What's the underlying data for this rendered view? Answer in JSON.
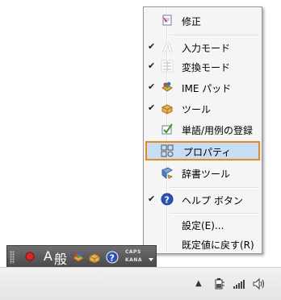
{
  "context_menu": {
    "items": [
      {
        "label": "修正",
        "checked": false,
        "icon": "edit-icon"
      },
      {
        "label": "入力モード",
        "checked": true,
        "icon": "input-mode-icon"
      },
      {
        "label": "変換モード",
        "checked": true,
        "icon": "conversion-mode-icon"
      },
      {
        "label": "IME パッド",
        "checked": true,
        "icon": "ime-pad-icon"
      },
      {
        "label": "ツール",
        "checked": true,
        "icon": "tools-icon"
      },
      {
        "label": "単語/用例の登録",
        "checked": false,
        "icon": "word-register-icon"
      },
      {
        "label": "プロパティ",
        "checked": false,
        "icon": "properties-icon",
        "highlighted": true
      },
      {
        "label": "辞書ツール",
        "checked": false,
        "icon": "dictionary-tool-icon"
      },
      {
        "label": "ヘルプ ボタン",
        "checked": true,
        "icon": "help-icon"
      },
      {
        "label": "設定(E)...",
        "checked": false
      },
      {
        "label": "既定値に戻す(R)",
        "checked": false
      }
    ],
    "check_mark": "✔",
    "highlight_color": "#c5def5",
    "highlight_border_color": "#f0851a"
  },
  "language_bar": {
    "input_mode_glyph": "A",
    "conversion_mode_glyph": "般",
    "caps_label": "CAPS",
    "kana_label": "KANA",
    "background_color": "#4f4f4f"
  },
  "taskbar": {
    "tray_icons": [
      "show-hidden-icons-chevron",
      "power-icon",
      "network-signal-icon",
      "volume-icon"
    ],
    "chevron_glyph": "▲"
  }
}
